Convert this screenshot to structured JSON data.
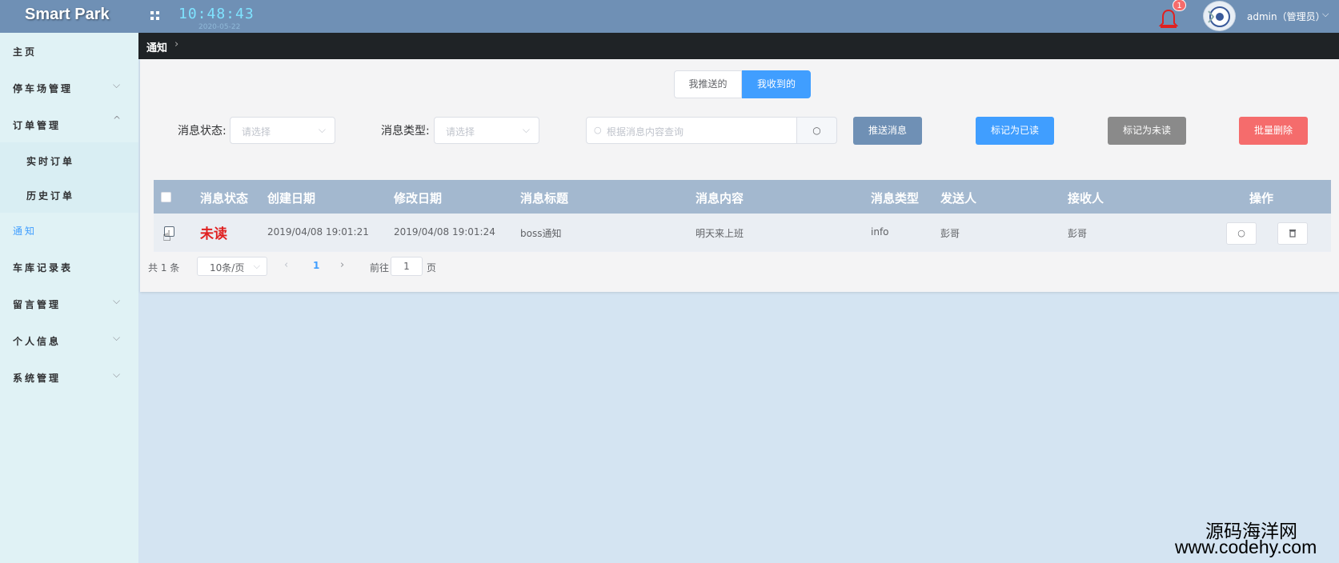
{
  "header": {
    "brand": "Smart Park",
    "time": "10:48:43",
    "date": "2020-05-22",
    "notification_count": "1",
    "user": "admin（管理员）"
  },
  "sidebar": {
    "items": [
      {
        "label": "主页"
      },
      {
        "label": "停车场管理"
      },
      {
        "label": "订单管理"
      },
      {
        "label": "实时订单"
      },
      {
        "label": "历史订单"
      },
      {
        "label": "通知"
      },
      {
        "label": "车库记录表"
      },
      {
        "label": "留言管理"
      },
      {
        "label": "个人信息"
      },
      {
        "label": "系统管理"
      }
    ]
  },
  "breadcrumb": {
    "current": "通知"
  },
  "tabs": {
    "sent": "我推送的",
    "received": "我收到的"
  },
  "filters": {
    "status_label": "消息状态:",
    "status_placeholder": "请选择",
    "type_label": "消息类型:",
    "type_placeholder": "请选择",
    "search_placeholder": "根据消息内容查询"
  },
  "actions": {
    "push": "推送消息",
    "mark_read": "标记为已读",
    "mark_unread": "标记为未读",
    "batch_delete": "批量删除"
  },
  "table": {
    "headers": [
      "消息状态",
      "创建日期",
      "修改日期",
      "消息标题",
      "消息内容",
      "消息类型",
      "发送人",
      "接收人",
      "操作"
    ],
    "rows": [
      {
        "status": "未读",
        "created": "2019/04/08 19:01:21",
        "modified": "2019/04/08 19:01:24",
        "title": "boss通知",
        "content": "明天来上班",
        "type": "info",
        "sender": "彭哥",
        "receiver": "彭哥"
      }
    ]
  },
  "pagination": {
    "total": "共 1 条",
    "page_size": "10条/页",
    "current_page": "1",
    "goto_label": "前往",
    "goto_value": "1",
    "page_suffix": "页"
  },
  "watermark": {
    "line1": "源码海洋网",
    "line2": "www.codehy.com"
  },
  "colors": {
    "header_bg": "#6f90b5",
    "sidebar_bg": "#e0f2f5",
    "primary": "#409eff",
    "danger": "#f56c6c",
    "unread": "#e02020",
    "table_header": "#a3b8cf"
  }
}
